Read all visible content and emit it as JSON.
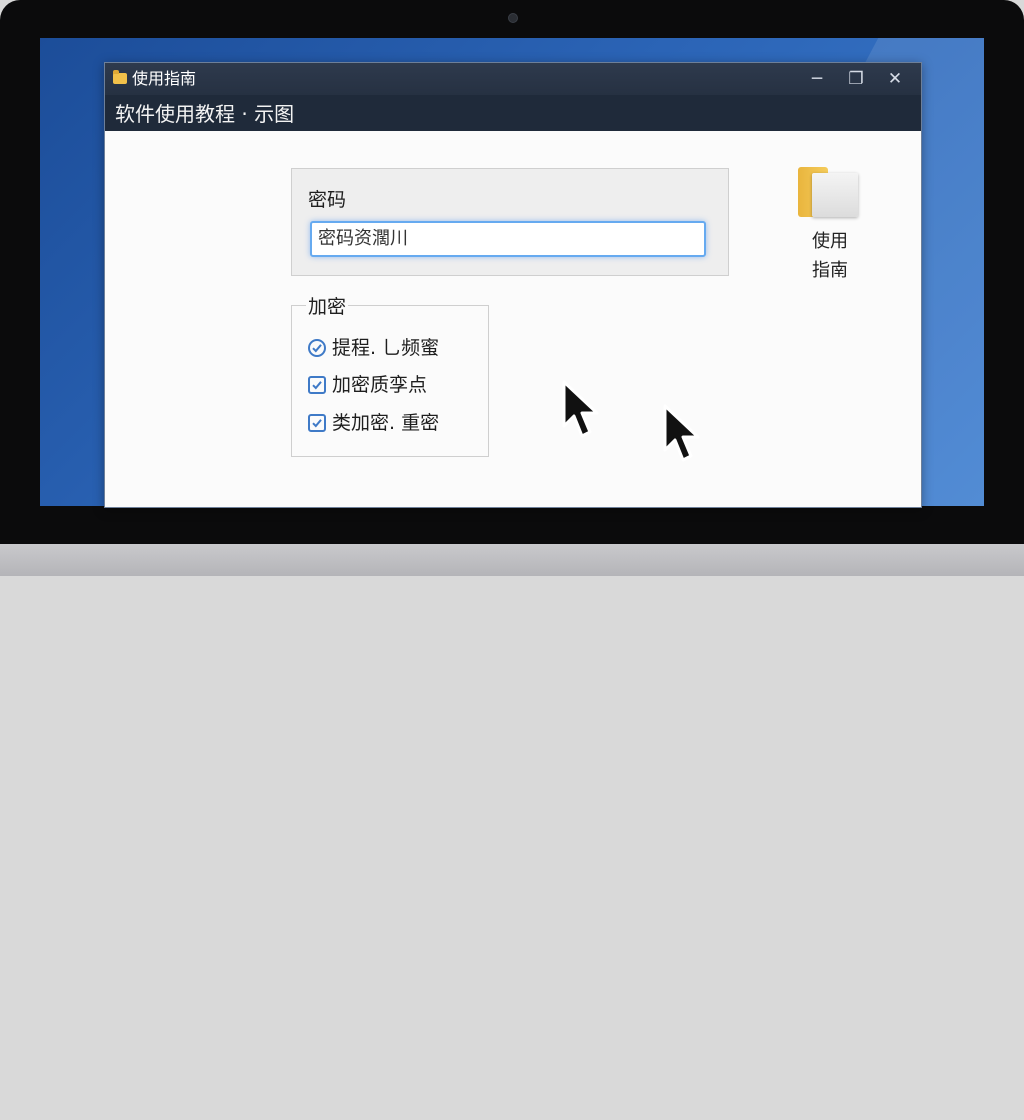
{
  "window": {
    "title": "使用指南",
    "subtitle": "软件使用教程 · 示图",
    "controls": {
      "minimize": "─",
      "maximize": "❐",
      "close": "✕"
    }
  },
  "password": {
    "label": "密码",
    "value": "密码资濶川"
  },
  "encryption": {
    "legend": "加密",
    "options": [
      {
        "label": "提程. 乚频蜜",
        "checked": true,
        "style": "round"
      },
      {
        "label": "加密质孪点",
        "checked": true,
        "style": "square"
      },
      {
        "label": "类加密. 重密",
        "checked": true,
        "style": "square"
      }
    ]
  },
  "desktop_icon": {
    "label_line1": "使用",
    "label_line2": "指南",
    "icon": "folder-icon"
  },
  "colors": {
    "accent": "#3f7ac7",
    "titlebar": "#263142",
    "desktop": "#2b64b6",
    "folder": "#f2c14a"
  }
}
